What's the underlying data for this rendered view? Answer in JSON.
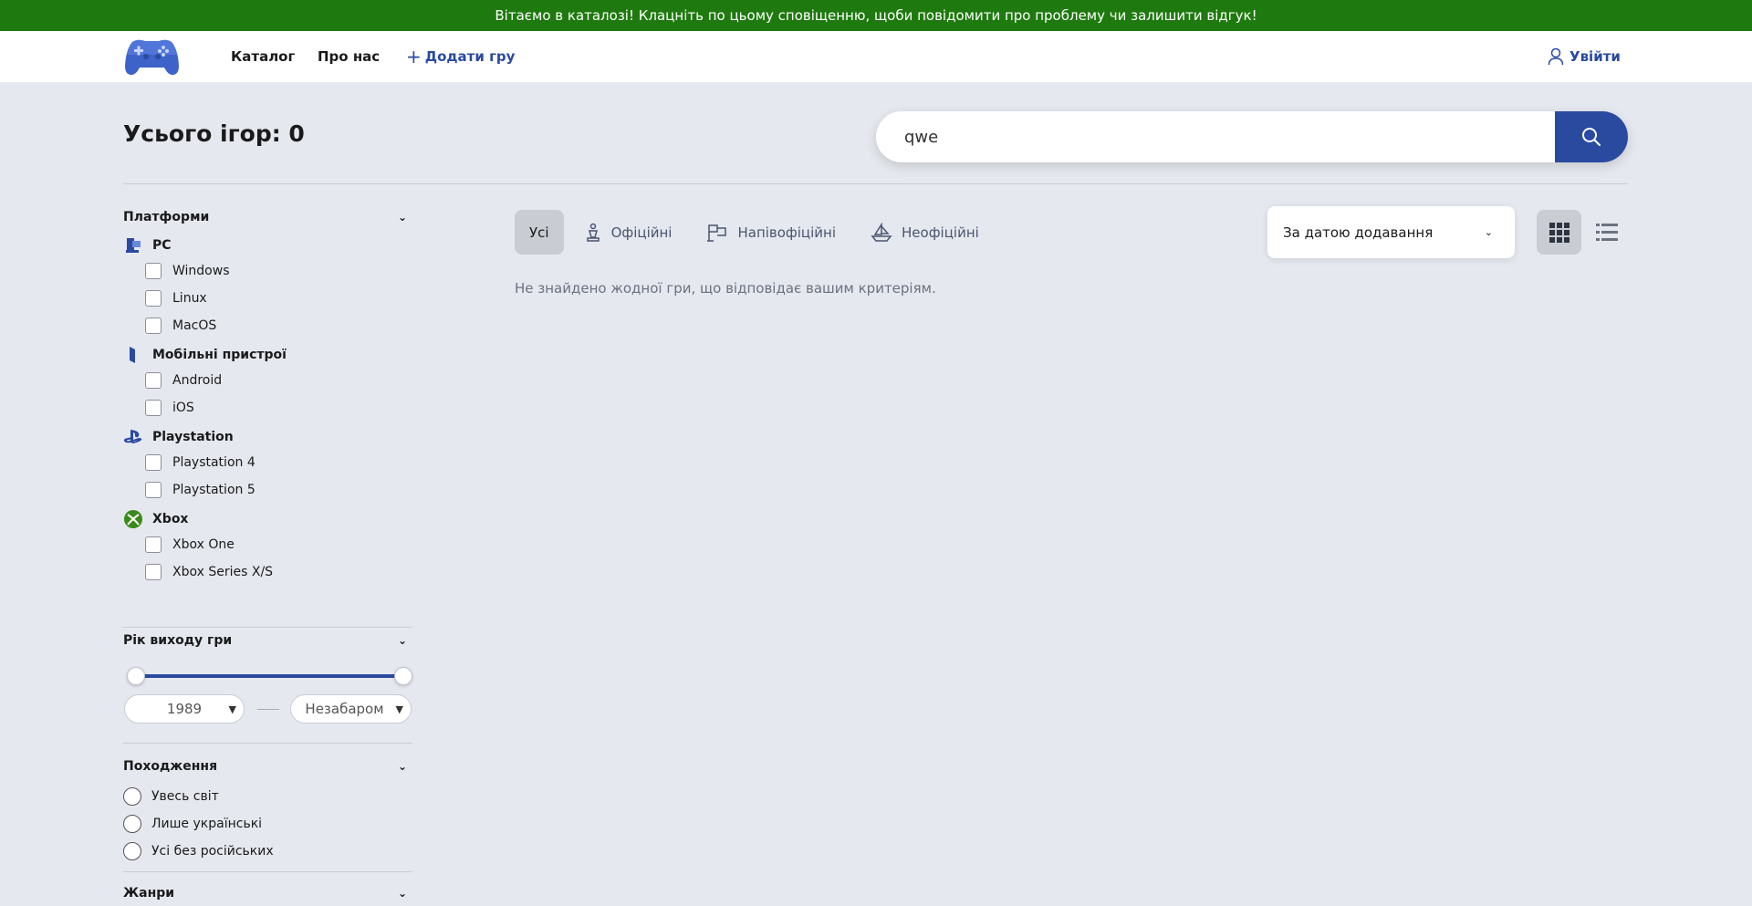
{
  "banner": {
    "text": "Вітаємо в каталозі! Клацніть по цьому сповіщенню, щоби повідомити про проблему чи залишити відгук!"
  },
  "nav": {
    "catalog": "Каталог",
    "about": "Про нас",
    "add_game": "Додати гру",
    "login": "Увійти"
  },
  "page": {
    "title": "Усього ігор: 0"
  },
  "search": {
    "value": "qwe"
  },
  "sidebar": {
    "platforms_title": "Платформи",
    "groups": [
      {
        "title": "PC",
        "items": [
          "Windows",
          "Linux",
          "MacOS"
        ]
      },
      {
        "title": "Мобільні пристрої",
        "items": [
          "Android",
          "iOS"
        ]
      },
      {
        "title": "Playstation",
        "items": [
          "Playstation 4",
          "Playstation 5"
        ]
      },
      {
        "title": "Xbox",
        "items": [
          "Xbox One",
          "Xbox Series X/S"
        ]
      }
    ],
    "year_title": "Рік виходу гри",
    "year_from": "1989",
    "year_to": "Незабаром",
    "origin_title": "Походження",
    "origin_options": [
      "Увесь світ",
      "Лише українські",
      "Усі без російських"
    ],
    "genres_title": "Жанри"
  },
  "tabs": [
    "Усі",
    "Офіційні",
    "Напівофіційні",
    "Неофіційні"
  ],
  "sort": {
    "selected": "За датою додавання"
  },
  "results": {
    "empty_message": "Не знайдено жодної гри, що відповідає вашим критеріям."
  },
  "colors": {
    "banner": "#1e7a0e",
    "accent": "#2a4aa0",
    "background": "#e5e8ee"
  }
}
